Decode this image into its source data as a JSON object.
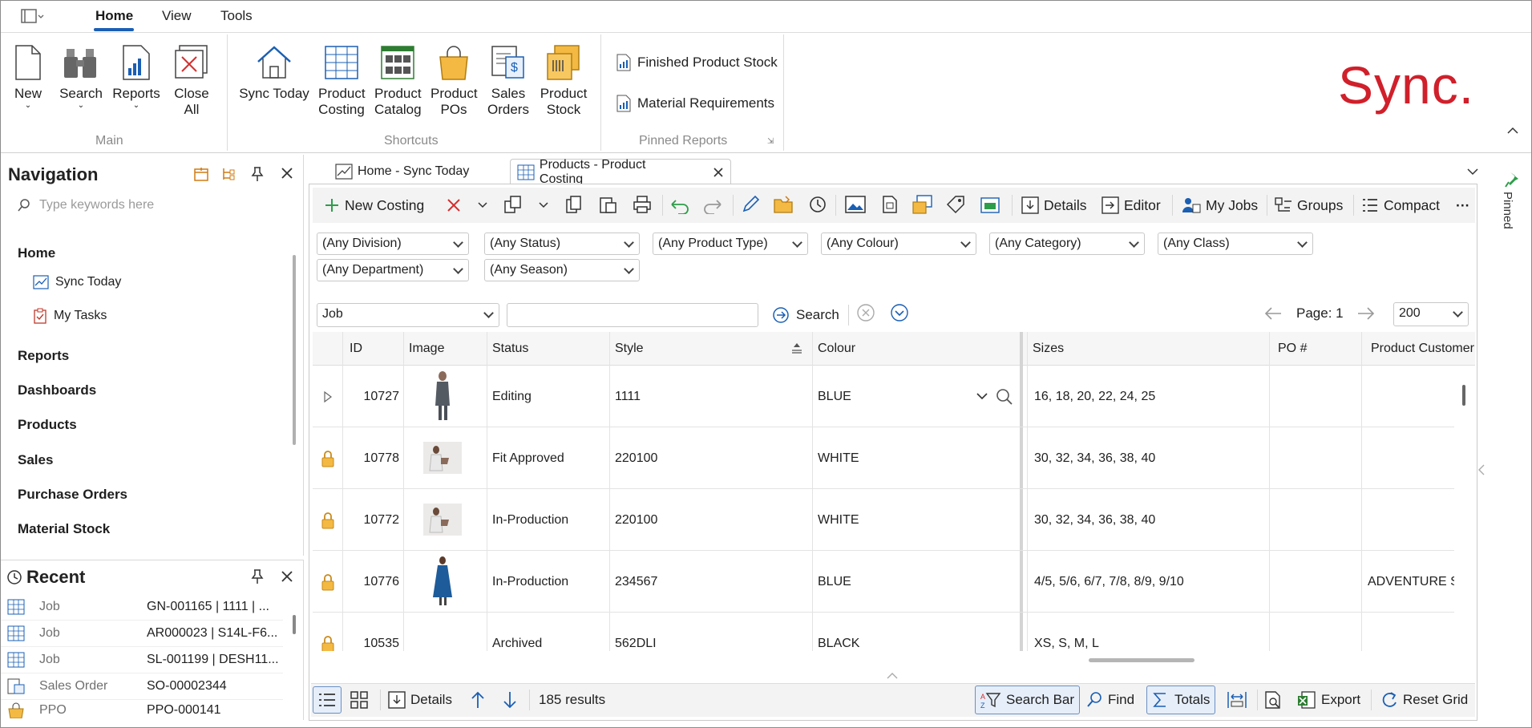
{
  "menu": {
    "tabs": [
      "Home",
      "View",
      "Tools"
    ]
  },
  "ribbon": {
    "main": {
      "new": "New",
      "search": "Search",
      "reports": "Reports",
      "close_all_1": "Close",
      "close_all_2": "All",
      "group": "Main"
    },
    "shortcuts": {
      "sync_today": "Sync Today",
      "product_costing_1": "Product",
      "product_costing_2": "Costing",
      "product_catalog_1": "Product",
      "product_catalog_2": "Catalog",
      "product_pos_1": "Product",
      "product_pos_2": "POs",
      "sales_orders_1": "Sales",
      "sales_orders_2": "Orders",
      "product_stock_1": "Product",
      "product_stock_2": "Stock",
      "group": "Shortcuts"
    },
    "pinned_reports": {
      "items": [
        "Finished Product Stock",
        "Material Requirements"
      ],
      "group": "Pinned Reports"
    },
    "brand": "Sync."
  },
  "navigation": {
    "title": "Navigation",
    "search_placeholder": "Type keywords here",
    "items": {
      "home": "Home",
      "sync_today": "Sync Today",
      "my_tasks": "My Tasks",
      "reports": "Reports",
      "dashboards": "Dashboards",
      "products": "Products",
      "sales": "Sales",
      "purchase_orders": "Purchase Orders",
      "material_stock": "Material Stock"
    }
  },
  "recent": {
    "title": "Recent",
    "rows": [
      {
        "type": "Job",
        "value": "GN-001165 | 1111 | ..."
      },
      {
        "type": "Job",
        "value": "AR000023 | S14L-F6..."
      },
      {
        "type": "Job",
        "value": "SL-001199 | DESH11..."
      },
      {
        "type": "Sales Order",
        "value": "SO-00002344"
      },
      {
        "type": "PPO",
        "value": "PPO-000141"
      }
    ]
  },
  "side_pinned": "Pinned",
  "tabs": {
    "home": "Home - Sync Today",
    "products": "Products - Product Costing"
  },
  "toolbar": {
    "new_costing": "New Costing",
    "details": "Details",
    "editor": "Editor",
    "my_jobs": "My Jobs",
    "groups": "Groups",
    "compact": "Compact",
    "more": "···"
  },
  "filters": {
    "division": "(Any Division)",
    "status": "(Any Status)",
    "product_type": "(Any Product Type)",
    "colour": "(Any Colour)",
    "category": "(Any Category)",
    "class": "(Any Class)",
    "department": "(Any Department)",
    "season": "(Any Season)"
  },
  "search": {
    "field": "Job",
    "value": "",
    "button": "Search",
    "page": "Page: 1",
    "page_size": "200"
  },
  "grid": {
    "columns": {
      "id": "ID",
      "image": "Image",
      "status": "Status",
      "style": "Style",
      "colour": "Colour",
      "sizes": "Sizes",
      "po": "PO #",
      "customer": "Product Customer"
    },
    "rows": [
      {
        "id": "10727",
        "status": "Editing",
        "style": "1111",
        "colour": "BLUE",
        "sizes": "16, 18, 20, 22, 24, 25",
        "po": "",
        "customer": ""
      },
      {
        "id": "10778",
        "status": "Fit Approved",
        "style": "220100",
        "colour": "WHITE",
        "sizes": "30, 32, 34, 36, 38, 40",
        "po": "",
        "customer": ""
      },
      {
        "id": "10772",
        "status": "In-Production",
        "style": "220100",
        "colour": "WHITE",
        "sizes": "30, 32, 34, 36, 38, 40",
        "po": "",
        "customer": ""
      },
      {
        "id": "10776",
        "status": "In-Production",
        "style": "234567",
        "colour": "BLUE",
        "sizes": "4/5, 5/6, 6/7, 7/8, 8/9, 9/10",
        "po": "",
        "customer": "ADVENTURE SF"
      },
      {
        "id": "10535",
        "status": "Archived",
        "style": "562DLI",
        "colour": "BLACK",
        "sizes": "XS, S, M, L",
        "po": "",
        "customer": ""
      }
    ]
  },
  "bottom": {
    "details": "Details",
    "results": "185 results",
    "search_bar": "Search Bar",
    "find": "Find",
    "totals": "Totals",
    "export": "Export",
    "reset_grid": "Reset Grid"
  }
}
